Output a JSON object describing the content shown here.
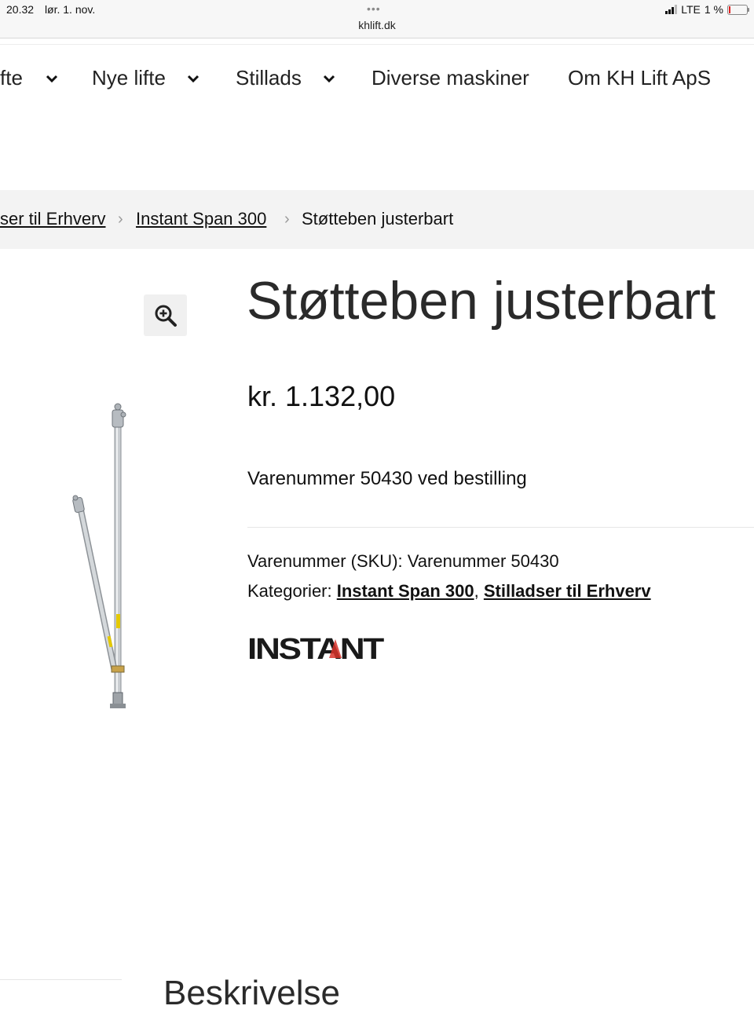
{
  "status_bar": {
    "time": "20.32",
    "date": "lør. 1. nov.",
    "url": "khlift.dk",
    "network": "LTE",
    "battery": "1 %"
  },
  "nav": {
    "items": [
      {
        "label": "fte",
        "has_dropdown": true
      },
      {
        "label": "Nye lifte",
        "has_dropdown": true
      },
      {
        "label": "Stillads",
        "has_dropdown": true
      },
      {
        "label": "Diverse maskiner",
        "has_dropdown": false
      },
      {
        "label": "Om KH Lift ApS",
        "has_dropdown": false
      }
    ]
  },
  "breadcrumb": {
    "items": [
      "ser til Erhverv",
      "Instant Span 300",
      "Støtteben justerbart"
    ],
    "separator": "›"
  },
  "product": {
    "title": "Støtteben justerbart",
    "price": "kr. 1.132,00",
    "short_description": "Varenummer 50430 ved bestilling",
    "sku_label": "Varenummer (SKU):",
    "sku_value": "Varenummer 50430",
    "categories_label": "Kategorier:",
    "categories": [
      "Instant Span 300",
      "Stilladser til Erhverv"
    ],
    "categories_separator": ",",
    "brand": "INSTANT",
    "brand_color": "#1a1a1a",
    "brand_accent": "#d8342b"
  },
  "tabs": {
    "heading": "Beskrivelse"
  },
  "icons": {
    "zoom": "magnifier-plus-icon",
    "chevron": "chevron-down-icon"
  }
}
